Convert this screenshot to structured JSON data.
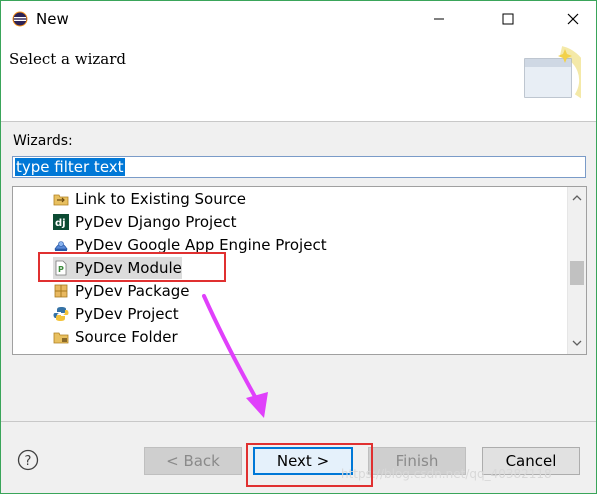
{
  "window": {
    "title": "New"
  },
  "header": {
    "text": "Select a wizard"
  },
  "wizards_label": "Wizards:",
  "filter": {
    "value": "type filter text"
  },
  "tree": {
    "items": [
      {
        "label": "Link to Existing Source",
        "icon": "link-folder-icon"
      },
      {
        "label": "PyDev Django Project",
        "icon": "django-icon"
      },
      {
        "label": "PyDev Google App Engine Project",
        "icon": "google-app-engine-icon"
      },
      {
        "label": "PyDev Module",
        "icon": "pydev-module-icon",
        "selected": true
      },
      {
        "label": "PyDev Package",
        "icon": "package-icon"
      },
      {
        "label": "PyDev Project",
        "icon": "python-icon"
      },
      {
        "label": "Source Folder",
        "icon": "source-folder-icon"
      }
    ]
  },
  "buttons": {
    "help": "?",
    "back": "< Back",
    "next": "Next >",
    "finish": "Finish",
    "cancel": "Cancel"
  },
  "watermark": "https://blog.csdn.net/qq_40382118",
  "colors": {
    "highlight": "#e03030",
    "arrow": "#e040fb",
    "selection": "#0078d7"
  }
}
